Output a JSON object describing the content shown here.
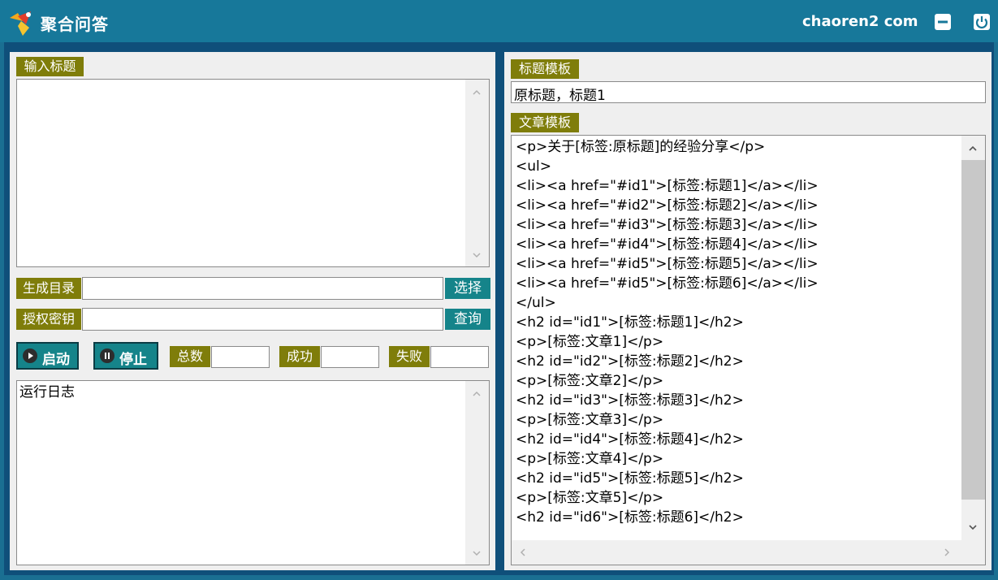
{
  "app": {
    "title": "聚合问答",
    "site": "chaoren2 com"
  },
  "left": {
    "input_title_label": "输入标题",
    "input_title_value": "",
    "gen_dir_label": "生成目录",
    "gen_dir_value": "",
    "select_button": "选择",
    "auth_key_label": "授权密钥",
    "auth_key_value": "",
    "query_button": "查询",
    "start_button": "启动",
    "stop_button": "停止",
    "total_label": "总数",
    "total_value": "",
    "success_label": "成功",
    "success_value": "",
    "fail_label": "失败",
    "fail_value": "",
    "log_text": "运行日志"
  },
  "right": {
    "title_template_label": "标题模板",
    "title_template_value": "原标题，标题1",
    "article_template_label": "文章模板",
    "article_lines": [
      "<p>关于[标签:原标题]的经验分享</p>",
      "<ul>",
      "<li><a href=\"#id1\">[标签:标题1]</a></li>",
      "<li><a href=\"#id2\">[标签:标题2]</a></li>",
      "<li><a href=\"#id3\">[标签:标题3]</a></li>",
      "<li><a href=\"#id4\">[标签:标题4]</a></li>",
      "<li><a href=\"#id5\">[标签:标题5]</a></li>",
      "<li><a href=\"#id5\">[标签:标题6]</a></li>",
      "</ul>",
      "<h2 id=\"id1\">[标签:标题1]</h2>",
      "<p>[标签:文章1]</p>",
      "<h2 id=\"id2\">[标签:标题2]</h2>",
      "<p>[标签:文章2]</p>",
      "<h2 id=\"id3\">[标签:标题3]</h2>",
      "<p>[标签:文章3]</p>",
      "<h2 id=\"id4\">[标签:标题4]</h2>",
      "<p>[标签:文章4]</p>",
      "<h2 id=\"id5\">[标签:标题5]</h2>",
      "<p>[标签:文章5]</p>",
      "<h2 id=\"id6\">[标签:标题6]</h2>"
    ]
  },
  "colors": {
    "titlebar": "#17789a",
    "tag": "#7f7d0a",
    "teal_button": "#15848a"
  },
  "icons": [
    "app-logo-icon",
    "minimize-icon",
    "power-icon",
    "play-icon",
    "pause-icon",
    "chevron-up-icon",
    "chevron-down-icon",
    "chevron-left-icon",
    "chevron-right-icon"
  ]
}
